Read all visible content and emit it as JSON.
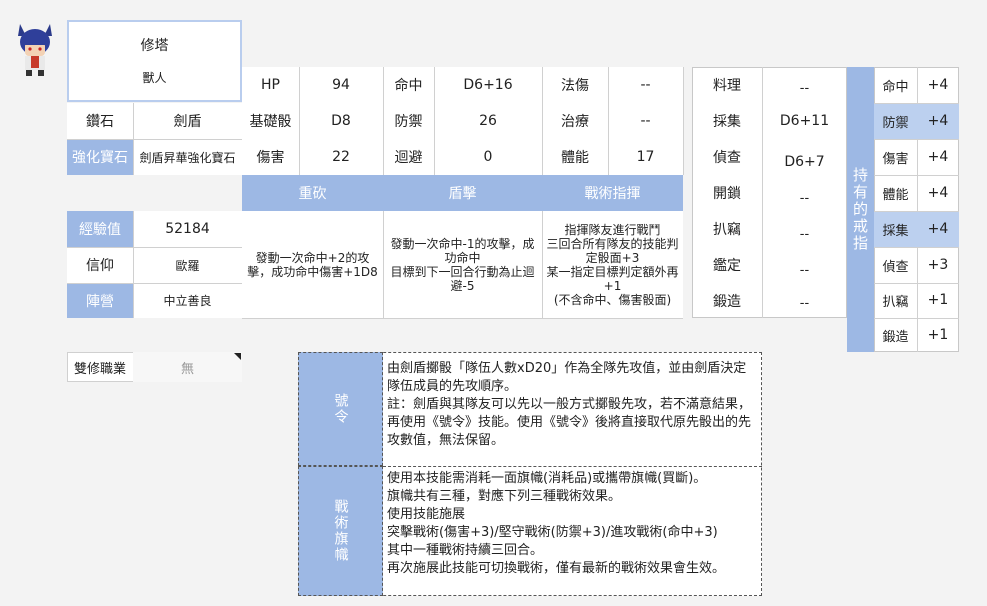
{
  "character": {
    "name": "修塔",
    "race": "獸人"
  },
  "left": {
    "gem_label": "鑽石",
    "gem_value": "劍盾",
    "enhance_label": "強化寶石",
    "enhance_value": "劍盾昇華強化寶石",
    "exp_label": "經驗值",
    "exp_value": "52184",
    "faith_label": "信仰",
    "faith_value": "歐羅",
    "camp_label": "陣營",
    "camp_value": "中立善良",
    "dual_label": "雙修職業",
    "dual_value": "無"
  },
  "stats": {
    "hp_label": "HP",
    "hp_value": "94",
    "hit_label": "命中",
    "hit_value": "D6+16",
    "magic_label": "法傷",
    "magic_value": "--",
    "base_label": "基礎骰",
    "base_value": "D8",
    "def_label": "防禦",
    "def_value": "26",
    "heal_label": "治療",
    "heal_value": "--",
    "dmg_label": "傷害",
    "dmg_value": "22",
    "evade_label": "迴避",
    "evade_value": "0",
    "stamina_label": "體能",
    "stamina_value": "17"
  },
  "skills": [
    {
      "name": "重砍",
      "desc": "發動一次命中+2的攻擊，成功命中傷害+1D8"
    },
    {
      "name": "盾擊",
      "desc": "發動一次命中-1的攻擊，成功命中\n目標到下一回合行動為止迴避-5"
    },
    {
      "name": "戰術指揮",
      "desc": "指揮隊友進行戰鬥\n三回合所有隊友的技能判定骰面+3\n某一指定目標判定額外再+1\n(不含命中、傷害骰面)"
    }
  ],
  "life": [
    {
      "label": "料理",
      "value": "--"
    },
    {
      "label": "採集",
      "value": "D6+11"
    },
    {
      "label": "偵查",
      "value": "D6+7"
    },
    {
      "label": "開鎖",
      "value": "--"
    },
    {
      "label": "扒竊",
      "value": "--"
    },
    {
      "label": "鑑定",
      "value": "--"
    },
    {
      "label": "鍛造",
      "value": "--"
    }
  ],
  "precepts": {
    "title": "持有的戒指",
    "items": [
      {
        "label": "命中",
        "value": "+4"
      },
      {
        "label": "防禦",
        "value": "+4"
      },
      {
        "label": "傷害",
        "value": "+4"
      },
      {
        "label": "體能",
        "value": "+4"
      },
      {
        "label": "採集",
        "value": "+4"
      },
      {
        "label": "偵查",
        "value": "+3"
      },
      {
        "label": "扒竊",
        "value": "+1"
      },
      {
        "label": "鍛造",
        "value": "+1"
      }
    ]
  },
  "notes": [
    {
      "title": "號令",
      "text": "由劍盾擲骰「隊伍人數xD20」作為全隊先攻值，並由劍盾決定隊伍成員的先攻順序。\n註：劍盾與其隊友可以先以一般方式擲骰先攻，若不滿意結果，再使用《號令》技能。使用《號令》後將直接取代原先骰出的先攻數值，無法保留。"
    },
    {
      "title": "戰術旗幟",
      "text": "使用本技能需消耗一面旗幟(消耗品)或攜帶旗幟(買斷)。\n旗幟共有三種，對應下列三種戰術效果。\n使用技能施展\n突擊戰術(傷害+3)/堅守戰術(防禦+3)/進攻戰術(命中+3)\n其中一種戰術持續三回合。\n再次施展此技能可切換戰術，僅有最新的戰術效果會生效。"
    }
  ],
  "colors": {
    "accent": "#9db8e4",
    "accent_light": "#bcd0ef"
  }
}
